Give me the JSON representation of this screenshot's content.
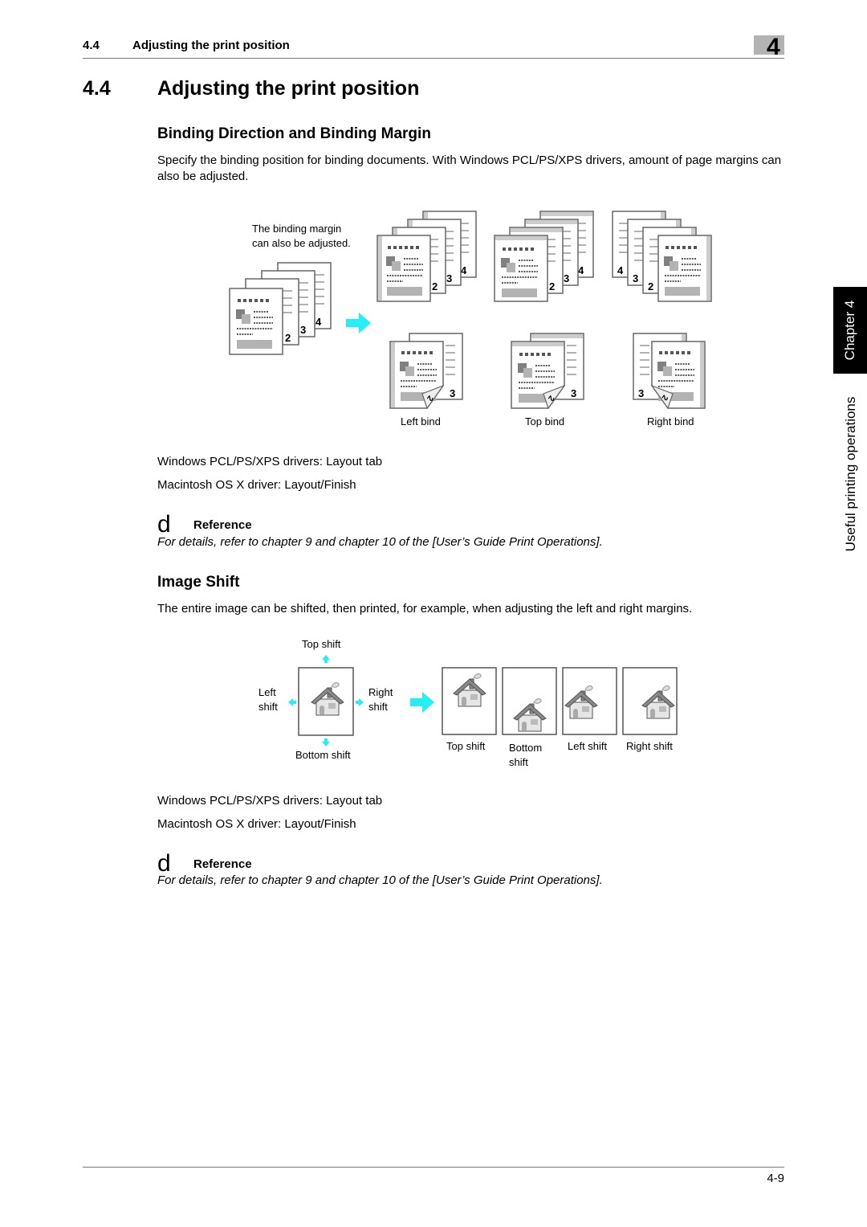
{
  "header": {
    "section_number": "4.4",
    "section_title": "Adjusting the print position",
    "chapter_number": "4"
  },
  "title": {
    "number": "4.4",
    "text": "Adjusting the print position"
  },
  "side": {
    "chapter_tab": "Chapter 4",
    "chapter_label": "Useful printing operations"
  },
  "binding": {
    "heading": "Binding Direction and Binding Margin",
    "body": "Specify the binding position for binding documents. With Windows PCL/PS/XPS drivers, amount of page margins can also be adjusted.",
    "figure": {
      "note_line1": "The binding margin",
      "note_line2": "can also be adjusted.",
      "page_numbers": [
        "2",
        "3",
        "4"
      ],
      "captions": [
        "Left bind",
        "Top bind",
        "Right bind"
      ]
    },
    "driver_windows": "Windows PCL/PS/XPS drivers: Layout tab",
    "driver_mac": "Macintosh OS X driver: Layout/Finish",
    "reference": {
      "icon_glyph": "d",
      "label": "Reference",
      "text": "For details, refer to chapter 9 and chapter 10 of the [User’s Guide Print Operations]."
    }
  },
  "image_shift": {
    "heading": "Image Shift",
    "body": "The entire image can be shifted, then printed, for example, when adjusting the left and right margins.",
    "figure": {
      "top_label": "Top shift",
      "left_label_1": "Left",
      "left_label_2": "shift",
      "right_label_1": "Right",
      "right_label_2": "shift",
      "bottom_label": "Bottom shift",
      "results": [
        {
          "line1": "Top shift",
          "line2": ""
        },
        {
          "line1": "Bottom",
          "line2": "shift"
        },
        {
          "line1": "Left shift",
          "line2": ""
        },
        {
          "line1": "Right shift",
          "line2": ""
        }
      ]
    },
    "driver_windows": "Windows PCL/PS/XPS drivers: Layout tab",
    "driver_mac": "Macintosh OS X driver: Layout/Finish",
    "reference": {
      "icon_glyph": "d",
      "label": "Reference",
      "text": "For details, refer to chapter 9 and chapter 10 of the [User’s Guide Print Operations]."
    }
  },
  "footer": {
    "page_number": "4-9"
  },
  "colors": {
    "accent_arrow": "#22f0f5",
    "chapter_box": "#b3b3b3",
    "side_tab": "#000000"
  }
}
